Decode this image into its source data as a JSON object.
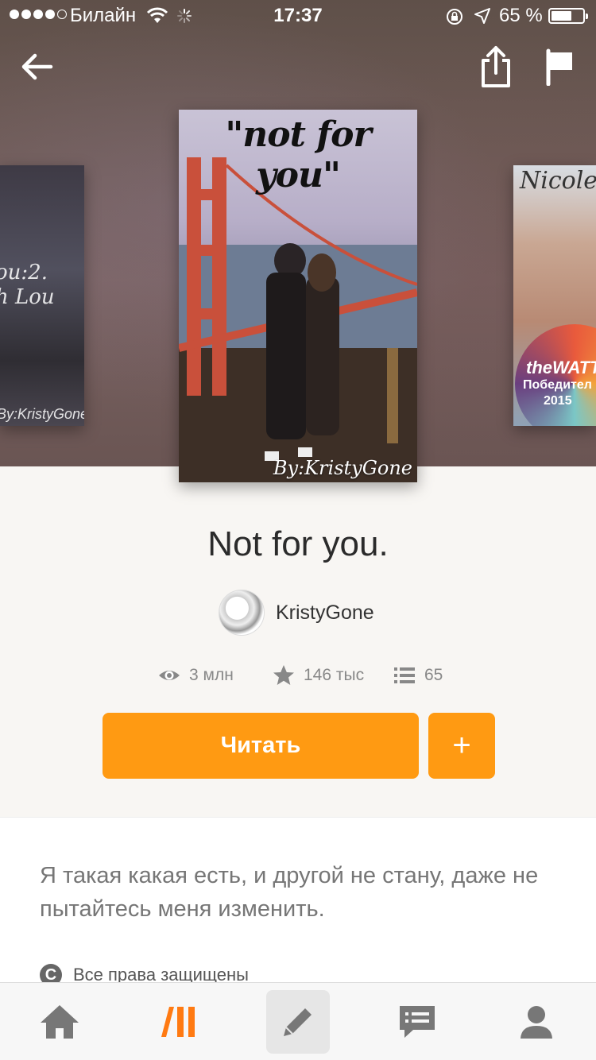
{
  "status_bar": {
    "carrier": "Билайн",
    "time": "17:37",
    "battery_percent_text": "65 %",
    "battery_level": 0.65
  },
  "toolbar": {
    "back_icon": "arrow-left-icon",
    "share_icon": "share-icon",
    "flag_icon": "flag-icon"
  },
  "covers": {
    "center": {
      "title": "\"not for you\"",
      "byline": "By:KristyGone"
    },
    "left": {
      "title_fragment": "ou:2.\nh Lou",
      "byline": "By:KristyGone"
    },
    "right": {
      "name": "Nicoles",
      "badge_title": "theWATTY",
      "badge_sub": "Победител",
      "badge_year": "2015"
    }
  },
  "book": {
    "title": "Not for you.",
    "author": "KristyGone"
  },
  "stats": {
    "views": "3 млн",
    "votes": "146 тыс",
    "parts": "65"
  },
  "actions": {
    "read_label": "Читать",
    "add_label": "+"
  },
  "description": {
    "text": "Я такая какая есть, и другой не стану, даже не пытайтесь меня изменить.",
    "rights": "Все права защищены"
  },
  "tabbar": {
    "items": [
      "home-icon",
      "library-icon",
      "write-icon",
      "messages-icon",
      "profile-icon"
    ]
  },
  "colors": {
    "accent": "#ff9a12",
    "text_primary": "#2b2b2b",
    "text_muted": "#888888"
  }
}
